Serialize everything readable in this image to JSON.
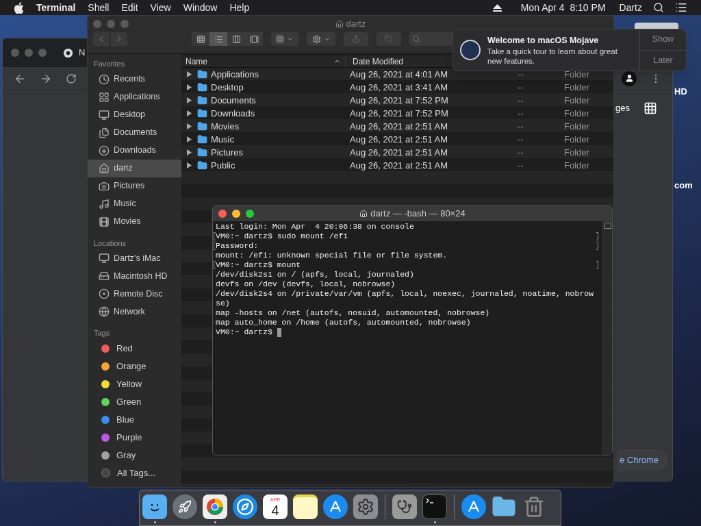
{
  "menu_bar": {
    "app": "Terminal",
    "menus": [
      "Shell",
      "Edit",
      "View",
      "Window",
      "Help"
    ],
    "clock": "Mon Apr 4  8:10 PM",
    "user": "Dartz"
  },
  "desktop": {
    "labels": [
      "HD",
      "com"
    ]
  },
  "browser": {
    "tab_title": "N",
    "link": "ges",
    "button": "e Chrome"
  },
  "finder": {
    "title": "dartz",
    "view_buttons": [
      {
        "selected": false
      },
      {
        "selected": true
      },
      {
        "selected": false
      },
      {
        "selected": false
      }
    ],
    "sidebar": [
      {
        "heading": "Favorites",
        "items": [
          {
            "label": "Recents",
            "selected": false
          },
          {
            "label": "Applications",
            "selected": false
          },
          {
            "label": "Desktop",
            "selected": false
          },
          {
            "label": "Documents",
            "selected": false
          },
          {
            "label": "Downloads",
            "selected": false
          },
          {
            "label": "dartz",
            "selected": true
          },
          {
            "label": "Pictures",
            "selected": false
          },
          {
            "label": "Music",
            "selected": false
          },
          {
            "label": "Movies",
            "selected": false
          }
        ]
      },
      {
        "heading": "Locations",
        "items": [
          {
            "label": "Dartz’s iMac",
            "selected": false
          },
          {
            "label": "Macintosh HD",
            "selected": false
          },
          {
            "label": "Remote Disc",
            "selected": false
          },
          {
            "label": "Network",
            "selected": false
          }
        ]
      }
    ],
    "tags": {
      "heading": "Tags",
      "items": [
        {
          "label": "Red",
          "color": "#ec5f5d"
        },
        {
          "label": "Orange",
          "color": "#f5a533"
        },
        {
          "label": "Yellow",
          "color": "#f4dd3b"
        },
        {
          "label": "Green",
          "color": "#5fd35c"
        },
        {
          "label": "Blue",
          "color": "#3b8df0"
        },
        {
          "label": "Purple",
          "color": "#bf5ae0"
        },
        {
          "label": "Gray",
          "color": "#a1a1a4"
        }
      ],
      "all": "All Tags..."
    },
    "columns": [
      "Name",
      "Date Modified"
    ],
    "rows": [
      {
        "name": "Applications",
        "date": "Aug 26, 2021 at 4:01 AM",
        "size": "--",
        "kind": "Folder"
      },
      {
        "name": "Desktop",
        "date": "Aug 26, 2021 at 3:41 AM",
        "size": "--",
        "kind": "Folder"
      },
      {
        "name": "Documents",
        "date": "Aug 26, 2021 at 7:52 PM",
        "size": "--",
        "kind": "Folder"
      },
      {
        "name": "Downloads",
        "date": "Aug 26, 2021 at 7:52 PM",
        "size": "--",
        "kind": "Folder"
      },
      {
        "name": "Movies",
        "date": "Aug 26, 2021 at 2:51 AM",
        "size": "--",
        "kind": "Folder"
      },
      {
        "name": "Music",
        "date": "Aug 26, 2021 at 2:51 AM",
        "size": "--",
        "kind": "Folder"
      },
      {
        "name": "Pictures",
        "date": "Aug 26, 2021 at 2:51 AM",
        "size": "--",
        "kind": "Folder"
      },
      {
        "name": "Public",
        "date": "Aug 26, 2021 at 2:51 AM",
        "size": "--",
        "kind": "Folder"
      }
    ]
  },
  "notification": {
    "title": "Welcome to macOS Mojave",
    "body": "Take a quick tour to learn about great new features.",
    "actions": [
      "Show",
      "Later"
    ]
  },
  "terminal": {
    "title": "dartz — -bash — 80×24",
    "lines": [
      {
        "text": "Last login: Mon Apr  4 20:06:38 on console",
        "marked": false
      },
      {
        "text": "VM0:~ dartz$ sudo mount /efi",
        "marked": true
      },
      {
        "text": "Password:",
        "marked": true
      },
      {
        "text": "mount: /efi: unknown special file or file system.",
        "marked": false
      },
      {
        "text": "VM0:~ dartz$ mount",
        "marked": true
      },
      {
        "text": "/dev/disk2s1 on / (apfs, local, journaled)",
        "marked": false
      },
      {
        "text": "devfs on /dev (devfs, local, nobrowse)",
        "marked": false
      },
      {
        "text": "/dev/disk2s4 on /private/var/vm (apfs, local, noexec, journaled, noatime, nobrow",
        "marked": false
      },
      {
        "text": "se)",
        "marked": false
      },
      {
        "text": "map -hosts on /net (autofs, nosuid, automounted, nobrowse)",
        "marked": false
      },
      {
        "text": "map auto_home on /home (autofs, automounted, nobrowse)",
        "marked": false
      }
    ],
    "prompt": "VM0:~ dartz$"
  },
  "dock": {
    "calendar_month": "APR",
    "calendar_day": "4",
    "running": [
      true,
      false,
      true,
      false,
      false,
      false,
      false,
      false,
      false,
      true,
      false,
      false,
      false
    ]
  }
}
